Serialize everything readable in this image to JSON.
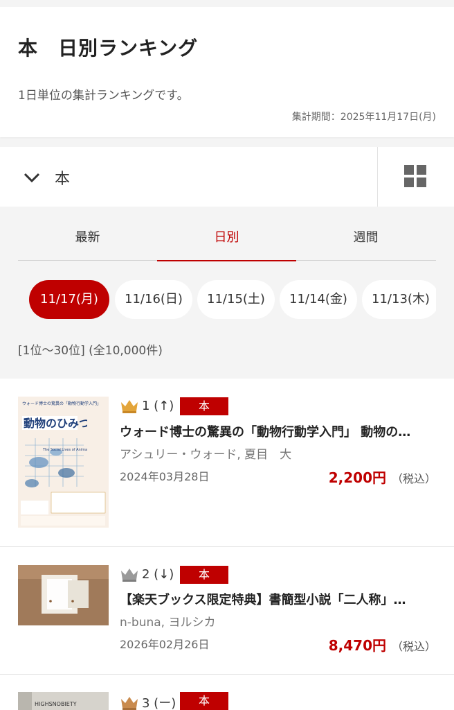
{
  "header": {
    "title": "本　日別ランキング",
    "description": "1日単位の集計ランキングです。",
    "period": "集計期間：2025年11月17日(月)"
  },
  "category": {
    "label": "本"
  },
  "tabs": [
    {
      "label": "最新",
      "active": false
    },
    {
      "label": "日別",
      "active": true
    },
    {
      "label": "週間",
      "active": false
    }
  ],
  "dates": [
    {
      "label": "11/17(月)",
      "active": true
    },
    {
      "label": "11/16(日)",
      "active": false
    },
    {
      "label": "11/15(土)",
      "active": false
    },
    {
      "label": "11/14(金)",
      "active": false
    },
    {
      "label": "11/13(木)",
      "active": false
    }
  ],
  "result_count": "[1位〜30位] (全10,000件)",
  "items": [
    {
      "rank": "1 (↑)",
      "badge": "本",
      "title": "ウォード博士の驚異の「動物行動学入門」 動物の…",
      "author": "アシュリー・ウォード, 夏目　大",
      "date": "2024年03月28日",
      "price": "2,200円",
      "tax": "（税込）",
      "crown": "gold-crown-icon"
    },
    {
      "rank": "2 (↓)",
      "badge": "本",
      "title": "【楽天ブックス限定特典】書簡型小説「二人称」…",
      "author": "n-buna, ヨルシカ",
      "date": "2026年02月26日",
      "price": "8,470円",
      "tax": "（税込）",
      "crown": "silver-crown-icon"
    },
    {
      "rank": "3 (ー)",
      "badge": "本",
      "crown": "bronze-crown-icon"
    }
  ],
  "cover_text": {
    "item1_headline": "動物のひみつ",
    "item1_sub": "The Social Lives of Animals",
    "item1_top": "ウォード博士の驚異の「動物行動学入門」",
    "item3_top": "HIGHSNOBIETY"
  },
  "colors": {
    "accent": "#bf0000",
    "gold": "#e3a53a",
    "silver": "#9a9a9a",
    "bronze": "#c98b4e"
  }
}
